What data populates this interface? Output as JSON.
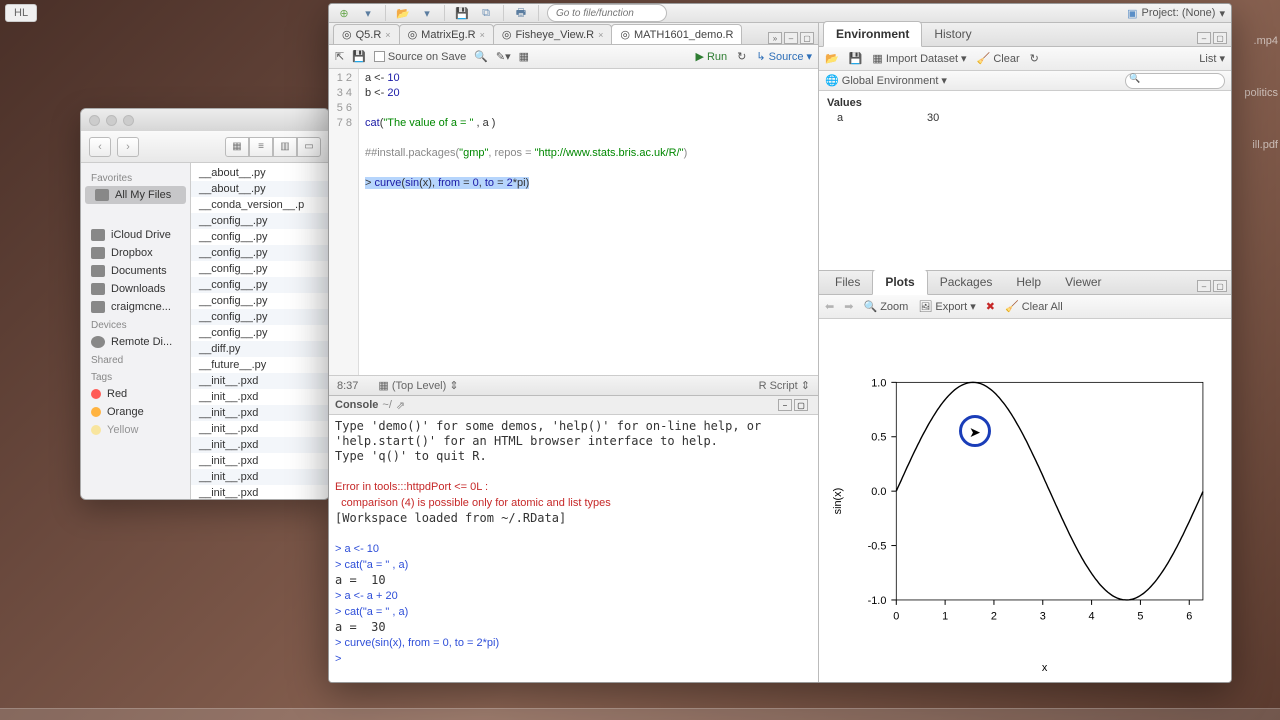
{
  "badge": "HL",
  "finder": {
    "sidebar": {
      "favorites_label": "Favorites",
      "items": [
        "All My Files",
        "iCloud Drive",
        "Dropbox",
        "Documents",
        "Downloads",
        "craigmcne..."
      ],
      "devices_label": "Devices",
      "devices": [
        "Remote Di..."
      ],
      "shared_label": "Shared",
      "tags_label": "Tags",
      "tags": [
        {
          "label": "Red",
          "color": "#ff5b56"
        },
        {
          "label": "Orange",
          "color": "#ffb340"
        },
        {
          "label": "Yellow",
          "color": "#ffd94a"
        }
      ]
    },
    "files": [
      "__about__.py",
      "__about__.py",
      "__conda_version__.p",
      "__config__.py",
      "__config__.py",
      "__config__.py",
      "__config__.py",
      "__config__.py",
      "__config__.py",
      "__config__.py",
      "__config__.py",
      "__diff.py",
      "__future__.py",
      "__init__.pxd",
      "__init__.pxd",
      "__init__.pxd",
      "__init__.pxd",
      "__init__.pxd",
      "__init__.pxd",
      "__init__.pxd",
      "__init__.pxd"
    ]
  },
  "rstudio": {
    "project_label": "Project: (None)",
    "go_placeholder": "Go to file/function",
    "tabs": [
      {
        "label": "Q5.R"
      },
      {
        "label": "MatrixEg.R"
      },
      {
        "label": "Fisheye_View.R"
      },
      {
        "label": "MATH1601_demo.R"
      }
    ],
    "source_on_save": "Source on Save",
    "run_label": "Run",
    "source_label": "Source",
    "code": {
      "lines": [
        {
          "n": "1",
          "raw": "a <- 10"
        },
        {
          "n": "2",
          "raw": "b <- 20"
        },
        {
          "n": "3",
          "raw": ""
        },
        {
          "n": "4",
          "raw": "cat(\"The value of a = \" , a )"
        },
        {
          "n": "5",
          "raw": ""
        },
        {
          "n": "6",
          "raw": "##install.packages(\"gmp\", repos = \"http://www.stats.bris.ac.uk/R/\")"
        },
        {
          "n": "7",
          "raw": ""
        },
        {
          "n": "8",
          "raw": "> curve(sin(x), from = 0, to = 2*pi)"
        }
      ]
    },
    "status_left": "8:37",
    "status_mid": "(Top Level)",
    "status_right": "R Script",
    "console": {
      "title": "Console",
      "path": "~/",
      "intro1": "Type 'demo()' for some demos, 'help()' for on-line help, or",
      "intro2": "'help.start()' for an HTML browser interface to help.",
      "intro3": "Type 'q()' to quit R.",
      "err1": "Error in tools:::httpdPort <= 0L :",
      "err2": "  comparison (4) is possible only for atomic and list types",
      "ws": "[Workspace loaded from ~/.RData]",
      "lines": [
        "> a <- 10",
        "> cat(\"a = \" , a)",
        "a =  10",
        "> a <- a + 20",
        "> cat(\"a = \" , a)",
        "a =  30",
        "> curve(sin(x), from = 0, to = 2*pi)",
        "> "
      ]
    },
    "env": {
      "tabs": [
        "Environment",
        "History"
      ],
      "import": "Import Dataset",
      "clear": "Clear",
      "scope": "Global Environment",
      "list": "List",
      "section": "Values",
      "vars": [
        {
          "name": "a",
          "value": "30"
        }
      ]
    },
    "plots": {
      "tabs": [
        "Files",
        "Plots",
        "Packages",
        "Help",
        "Viewer"
      ],
      "zoom": "Zoom",
      "export": "Export",
      "clearall": "Clear All"
    }
  },
  "chart_data": {
    "type": "line",
    "title": "",
    "xlabel": "x",
    "ylabel": "sin(x)",
    "xlim": [
      0,
      6.28
    ],
    "ylim": [
      -1.0,
      1.0
    ],
    "x_ticks": [
      0,
      1,
      2,
      3,
      4,
      5,
      6
    ],
    "y_ticks": [
      -1.0,
      -0.5,
      0.0,
      0.5,
      1.0
    ],
    "series": [
      {
        "name": "sin(x)",
        "function": "sin",
        "from": 0,
        "to": 6.2832
      }
    ]
  },
  "desktop_items": [
    "politics",
    "ill.pdf",
    ".mp4"
  ]
}
